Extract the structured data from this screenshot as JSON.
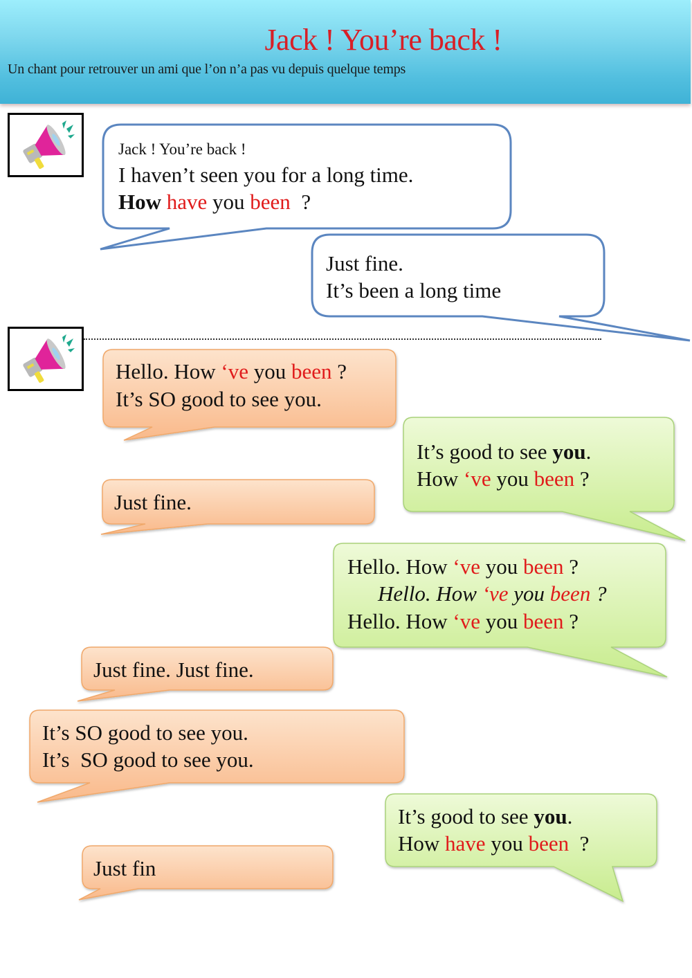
{
  "header": {
    "title": "Jack ! You’re back !",
    "subtitle": "Un chant pour retrouver un  ami que l’on n’a pas vu depuis quelque temps"
  },
  "icons": {
    "section1": "megaphone-icon",
    "section2": "megaphone-icon"
  },
  "colors": {
    "accent_red": "#e01b1b",
    "title_red": "#d81f26",
    "blue_outline": "#5b86c0",
    "orange_fill": "#fbc9a0",
    "green_fill": "#d5f0a8"
  },
  "section1": {
    "bubble1": {
      "line1": "Jack ! You’re back !",
      "line2": "I haven’t seen you for a long time.",
      "line3": {
        "w1": "How",
        "w2": "have",
        "w3": " you ",
        "w4": "been",
        "w5": "  ?"
      }
    },
    "bubble2": {
      "line1": "Just fine.",
      "line2": "It’s been a long time"
    }
  },
  "section2": {
    "b1": {
      "l1": {
        "a": "Hello. How ",
        "b": "‘ve",
        "c": " you ",
        "d": "been",
        "e": " ?"
      },
      "l2": "It’s SO good to see you."
    },
    "b2": {
      "l1": {
        "a": "It’s good to see ",
        "b": "you",
        "c": "."
      },
      "l2": {
        "a": "How ",
        "b": "‘ve",
        "c": " you ",
        "d": "been",
        "e": " ?"
      }
    },
    "b3": {
      "l1": "Just fine."
    },
    "b4": {
      "l1": {
        "a": "Hello. How ",
        "b": "‘ve",
        "c": " you ",
        "d": "been",
        "e": " ?"
      },
      "l2": {
        "a": "Hello. How ",
        "b": "‘ve",
        "c": " you ",
        "d": "been",
        "e": " ?"
      },
      "l3": {
        "a": "Hello. How ",
        "b": "‘ve",
        "c": " you ",
        "d": "been",
        "e": " ?"
      }
    },
    "b5": {
      "l1": "Just fine. Just fine."
    },
    "b6": {
      "l1": "It’s SO good to see you.",
      "l2": "It’s  SO good to see you."
    },
    "b7": {
      "l1": {
        "a": "It’s good to see ",
        "b": "you",
        "c": "."
      },
      "l2": {
        "a": "How ",
        "b": "have",
        "c": " you ",
        "d": "been",
        "e": "  ?"
      }
    },
    "b8": {
      "l1": "Just fin"
    }
  }
}
